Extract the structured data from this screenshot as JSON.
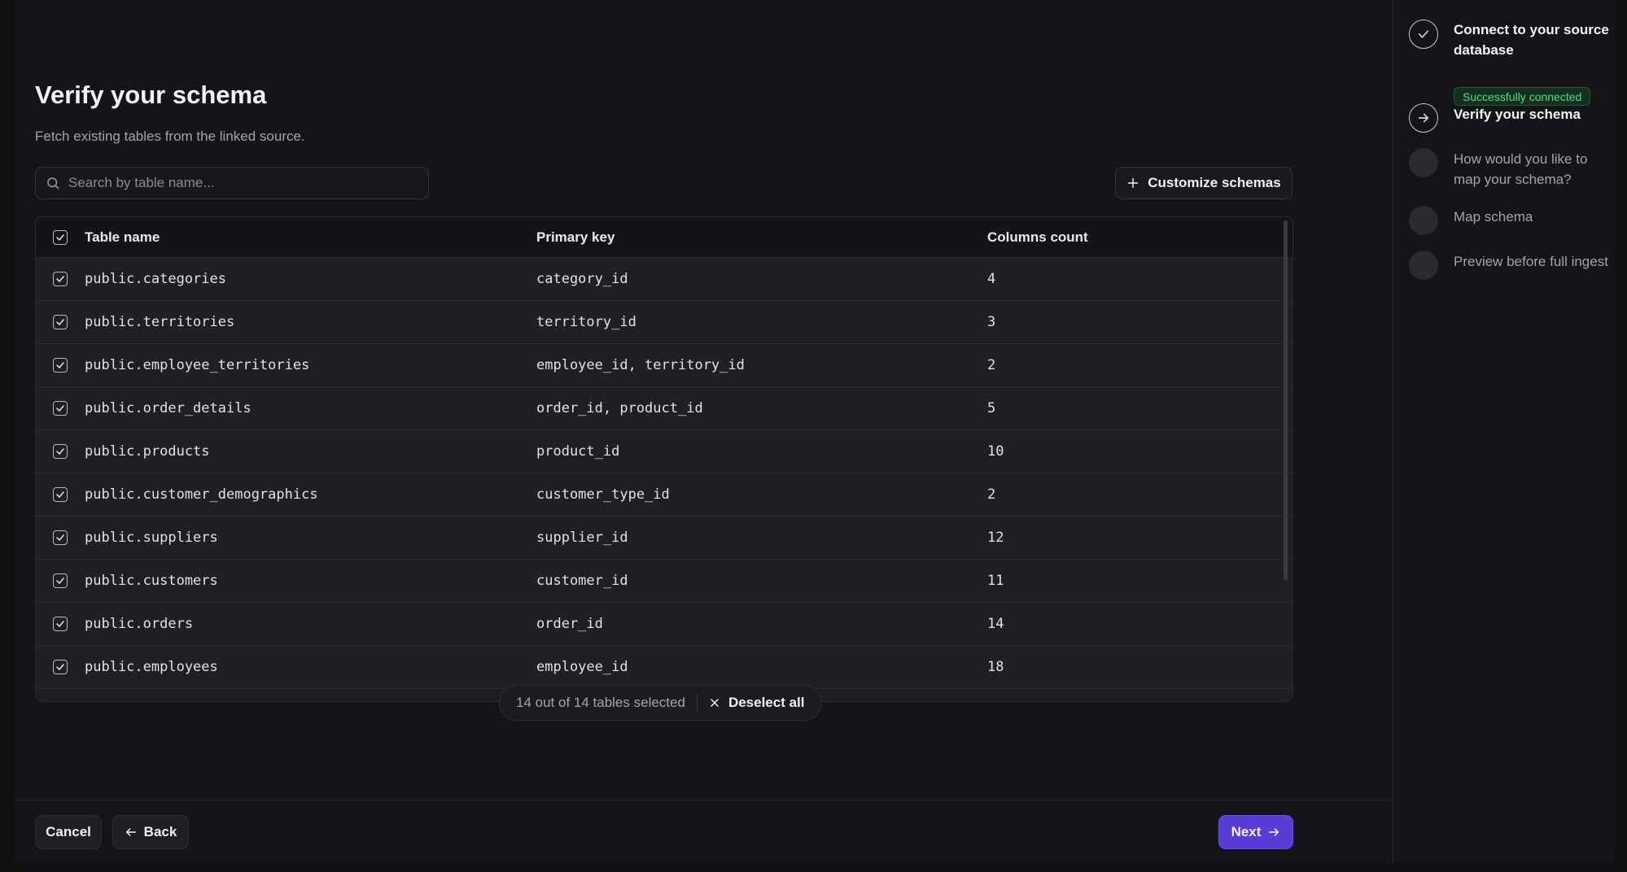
{
  "header": {
    "title": "Verify your schema",
    "subtitle": "Fetch existing tables from the linked source."
  },
  "search": {
    "placeholder": "Search by table name..."
  },
  "toolbar": {
    "customize_label": "Customize schemas"
  },
  "table": {
    "headers": {
      "name": "Table name",
      "pk": "Primary key",
      "count": "Columns count"
    },
    "rows": [
      {
        "name": "public.categories",
        "pk": "category_id",
        "count": "4"
      },
      {
        "name": "public.territories",
        "pk": "territory_id",
        "count": "3"
      },
      {
        "name": "public.employee_territories",
        "pk": "employee_id, territory_id",
        "count": "2"
      },
      {
        "name": "public.order_details",
        "pk": "order_id, product_id",
        "count": "5"
      },
      {
        "name": "public.products",
        "pk": "product_id",
        "count": "10"
      },
      {
        "name": "public.customer_demographics",
        "pk": "customer_type_id",
        "count": "2"
      },
      {
        "name": "public.suppliers",
        "pk": "supplier_id",
        "count": "12"
      },
      {
        "name": "public.customers",
        "pk": "customer_id",
        "count": "11"
      },
      {
        "name": "public.orders",
        "pk": "order_id",
        "count": "14"
      },
      {
        "name": "public.employees",
        "pk": "employee_id",
        "count": "18"
      }
    ]
  },
  "selection": {
    "status_text": "14 out of 14 tables selected",
    "deselect_label": "Deselect all"
  },
  "footer": {
    "cancel_label": "Cancel",
    "back_label": "Back",
    "next_label": "Next"
  },
  "steps": [
    {
      "label": "Connect to your source database",
      "state": "done",
      "badge": "Successfully connected"
    },
    {
      "label": "Verify your schema",
      "state": "current"
    },
    {
      "label": "How would you like to map your schema?",
      "state": "pending"
    },
    {
      "label": "Map schema",
      "state": "pending"
    },
    {
      "label": "Preview before full ingest",
      "state": "pending"
    }
  ],
  "colors": {
    "accent": "#5b3bd6",
    "success": "#4ade80",
    "background": "#151519"
  },
  "icons": [
    "search-icon",
    "plus-icon",
    "check-icon",
    "close-icon",
    "arrow-left-icon",
    "arrow-right-icon"
  ]
}
